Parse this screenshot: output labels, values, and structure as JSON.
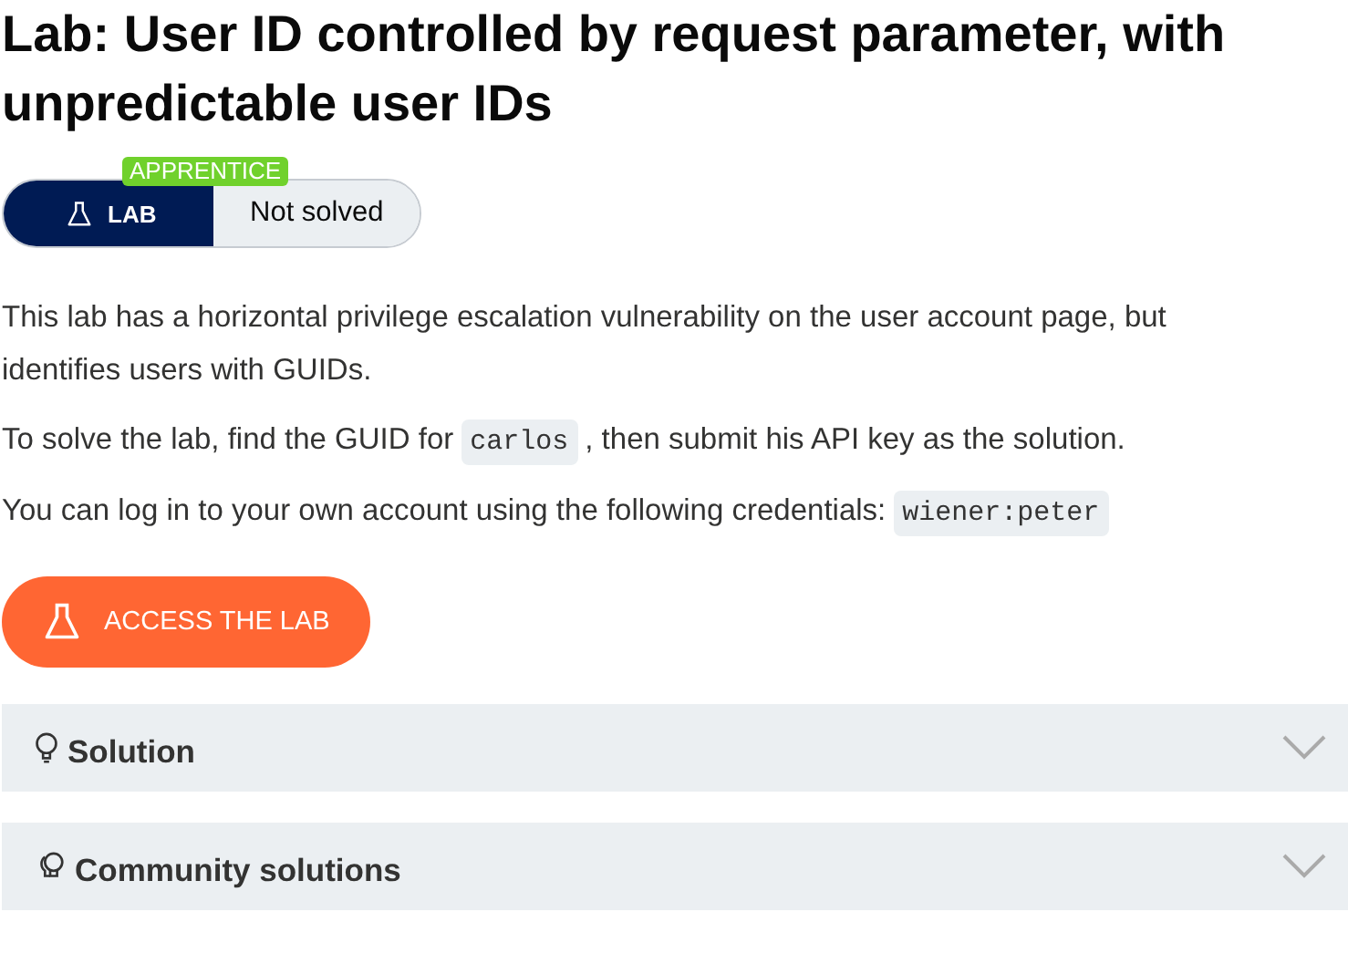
{
  "title": "Lab: User ID controlled by request parameter, with unpredictable user IDs",
  "badge": {
    "level": "APPRENTICE",
    "label": "LAB",
    "status": "Not solved",
    "solved": false
  },
  "paragraphs": [
    [
      {
        "kind": "text",
        "text": "This lab has a horizontal privilege escalation vulnerability on the user account page, but identifies users with GUIDs."
      }
    ],
    [
      {
        "kind": "text",
        "text": "To solve the lab, find the GUID for"
      },
      {
        "kind": "code",
        "text": "carlos"
      },
      {
        "kind": "text",
        "text": ", then submit his API key as the solution."
      }
    ],
    [
      {
        "kind": "text",
        "text": "You can log in to your own account using the following credentials:"
      },
      {
        "kind": "code",
        "text": "wiener:peter"
      }
    ]
  ],
  "access_button": "ACCESS THE LAB",
  "accordions": [
    {
      "title": "Solution",
      "kind": "single",
      "expanded": false
    },
    {
      "title": "Community solutions",
      "kind": "multi",
      "expanded": false
    }
  ]
}
